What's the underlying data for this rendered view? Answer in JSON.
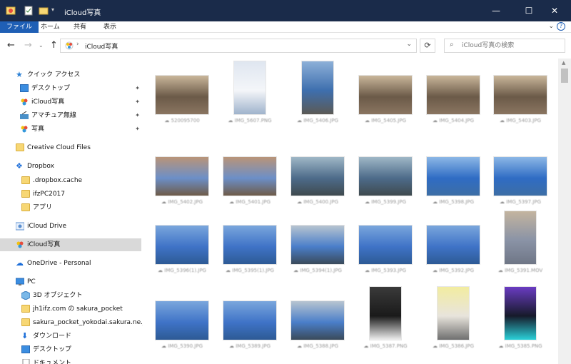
{
  "window": {
    "title": "iCloud写真",
    "controls": {
      "minimize": "—",
      "maximize": "☐",
      "close": "✕"
    }
  },
  "ribbon": {
    "tabs": [
      {
        "label": "ファイル",
        "active": true
      },
      {
        "label": "ホーム",
        "active": false
      },
      {
        "label": "共有",
        "active": false
      },
      {
        "label": "表示",
        "active": false
      }
    ],
    "expand_icon": "chevron-down-icon",
    "help_label": "?"
  },
  "address": {
    "path": "iCloud写真",
    "search_placeholder": "iCloud写真の検索"
  },
  "nav": {
    "quick_access": "クイック アクセス",
    "quick_items": [
      {
        "label": "デスクトップ",
        "icon": "desktop-icon",
        "pinned": true
      },
      {
        "label": "iCloud写真",
        "icon": "photos-icon",
        "pinned": true
      },
      {
        "label": "アマチュア無線",
        "icon": "radio-icon",
        "pinned": true
      },
      {
        "label": "写真",
        "icon": "photos-icon",
        "pinned": true
      }
    ],
    "creative_cloud": "Creative Cloud Files",
    "dropbox": "Dropbox",
    "dropbox_items": [
      ".dropbox.cache",
      "ifzPC2017",
      "アプリ"
    ],
    "icloud_drive": "iCloud Drive",
    "icloud_photos": "iCloud写真",
    "onedrive": "OneDrive - Personal",
    "pc": "PC",
    "pc_items": [
      {
        "label": "3D オブジェクト",
        "icon": "3d-objects-icon"
      },
      {
        "label": "jh1ifz.com の sakura_pocket",
        "icon": "folder-icon"
      },
      {
        "label": "sakura_pocket_yokodai.sakura.ne.jp",
        "icon": "folder-icon"
      },
      {
        "label": "ダウンロード",
        "icon": "download-icon"
      },
      {
        "label": "デスクトップ",
        "icon": "desktop-icon"
      },
      {
        "label": "ドキュメント",
        "icon": "documents-icon"
      }
    ]
  },
  "files": [
    {
      "name": "520095700",
      "type": "indoor"
    },
    {
      "name": "IMG_5607.PNG",
      "type": "screenshot"
    },
    {
      "name": "IMG_5406.JPG",
      "type": "street"
    },
    {
      "name": "IMG_5405.JPG",
      "type": "indoor"
    },
    {
      "name": "IMG_5404.JPG",
      "type": "indoor"
    },
    {
      "name": "IMG_5403.JPG",
      "type": "indoor"
    },
    {
      "name": "IMG_5402.JPG",
      "type": "road"
    },
    {
      "name": "IMG_5401.JPG",
      "type": "road"
    },
    {
      "name": "IMG_5400.JPG",
      "type": "bus"
    },
    {
      "name": "IMG_5399.JPG",
      "type": "bus"
    },
    {
      "name": "IMG_5398.JPG",
      "type": "city"
    },
    {
      "name": "IMG_5397.JPG",
      "type": "city"
    },
    {
      "name": "IMG_5396(1).JPG",
      "type": "sea"
    },
    {
      "name": "IMG_5395(1).JPG",
      "type": "sea"
    },
    {
      "name": "IMG_5394(1).JPG",
      "type": "ship"
    },
    {
      "name": "IMG_5393.JPG",
      "type": "sea"
    },
    {
      "name": "IMG_5392.JPG",
      "type": "sea"
    },
    {
      "name": "IMG_5391.MOV",
      "type": "video"
    },
    {
      "name": "IMG_5390.JPG",
      "type": "sea"
    },
    {
      "name": "IMG_5389.JPG",
      "type": "sea"
    },
    {
      "name": "IMG_5388.JPG",
      "type": "ship"
    },
    {
      "name": "IMG_5387.PNG",
      "type": "phone"
    },
    {
      "name": "IMG_5386.JPG",
      "type": "paper"
    },
    {
      "name": "IMG_5385.PNG",
      "type": "phone2"
    }
  ]
}
